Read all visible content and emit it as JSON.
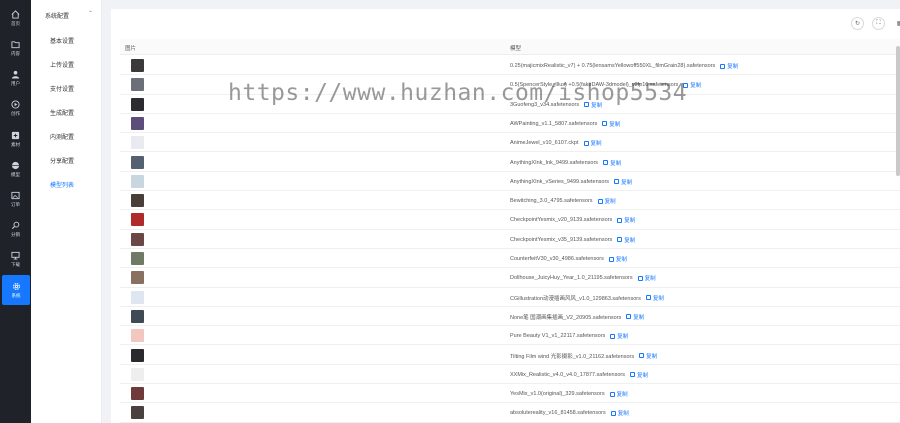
{
  "rail": {
    "items": [
      {
        "label": "首页",
        "icon": "home-icon"
      },
      {
        "label": "内容",
        "icon": "folder-icon"
      },
      {
        "label": "用户",
        "icon": "user-icon"
      },
      {
        "label": "创作",
        "icon": "play-icon"
      },
      {
        "label": "素材",
        "icon": "plus-box-icon"
      },
      {
        "label": "模型",
        "icon": "globe-icon"
      },
      {
        "label": "订单",
        "icon": "image-icon"
      },
      {
        "label": "分销",
        "icon": "search-icon"
      },
      {
        "label": "下载",
        "icon": "monitor-icon"
      },
      {
        "label": "系统",
        "icon": "gear-icon"
      }
    ],
    "active_index": 9
  },
  "submenu": {
    "header": "系统配置",
    "items": [
      "基本设置",
      "上传设置",
      "支付设置",
      "生成配置",
      "内测配置",
      "分享配置",
      "模型列表"
    ],
    "active_index": 6
  },
  "toolbar": {
    "refresh_icon": "refresh-icon",
    "fullscreen_icon": "fullscreen-icon",
    "settings_icon": "column-settings-icon"
  },
  "table": {
    "columns": [
      "图片",
      "模型"
    ],
    "copy_label": "复制",
    "rows": [
      {
        "model": "0.25(majicmixRealistic_v7) + 0.75(lensamsYellowoff550XL_filmGrain28).safetensors",
        "thumb": "#3a3a3a"
      },
      {
        "model": "0.5(SpencerStyle_Illus) +0.5(fakeDAW-3dmodel)_v2fp16.safetensors",
        "thumb": "#6a6f7a"
      },
      {
        "model": "3Guofeng3_v34.safetensors",
        "thumb": "#2c2c30"
      },
      {
        "model": "AWPainting_v1.1_5807.safetensors",
        "thumb": "#5d4d7a"
      },
      {
        "model": "AnimeJewel_v10_6107.ckpt",
        "thumb": "#e8eaf0"
      },
      {
        "model": "AnythingXInk_Ink_9499.safetensors",
        "thumb": "#556070"
      },
      {
        "model": "AnythingXInk_vSeries_9499.safetensors",
        "thumb": "#c8d6e0"
      },
      {
        "model": "Bewitching_3.0_4795.safetensors",
        "thumb": "#4a3e3a"
      },
      {
        "model": "CheckpointYesmix_v20_9139.safetensors",
        "thumb": "#b02a2a"
      },
      {
        "model": "CheckpointYesmix_v35_9139.safetensors",
        "thumb": "#6a4848"
      },
      {
        "model": "CounterfeitV30_v30_4986.safetensors",
        "thumb": "#707a66"
      },
      {
        "model": "Dollhouse_JuicyHuy_Year_1.0_21195.safetensors",
        "thumb": "#8a7060"
      },
      {
        "model": "CGillustration动漫插画风风_v1.0_129863.safetensors",
        "thumb": "#dfe6f2"
      },
      {
        "model": "None笔 国潮画集插画_V2_20905.safetensors",
        "thumb": "#3f4a55"
      },
      {
        "model": "Pure Beauty V1_v1_22117.safetensors",
        "thumb": "#f0c8c0"
      },
      {
        "model": "Tilting Film wind 光影摄影_v1.0_21162.safetensors",
        "thumb": "#2a2a2e"
      },
      {
        "model": "XXMix_Realistic_v4.0_v4.0_17877.safetensors",
        "thumb": "#eeeeee"
      },
      {
        "model": "YesMix_v1.0(original)_329.safetensors",
        "thumb": "#6e3a3a"
      },
      {
        "model": "absolutereality_v16_81458.safetensors",
        "thumb": "#4a4040"
      }
    ]
  },
  "watermark": "https://www.huzhan.com/ishop5534"
}
